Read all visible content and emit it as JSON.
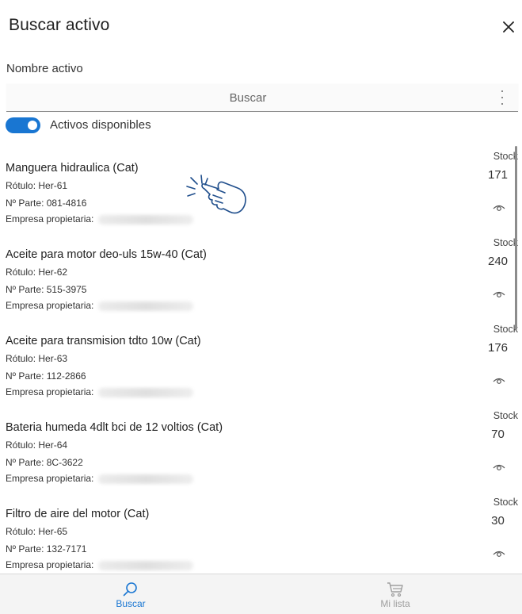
{
  "dialog": {
    "title": "Buscar activo",
    "close_icon": "close-icon"
  },
  "search": {
    "label": "Nombre activo",
    "placeholder": "Buscar",
    "value": "",
    "menu_icon": "more-vert-icon"
  },
  "filter": {
    "label": "Activos disponibles",
    "enabled": true,
    "accent_color": "#1976d2"
  },
  "assets": {
    "stock_label": "Stock",
    "rotulo_prefix": "Rótulo:",
    "part_prefix": "Nº Parte:",
    "owner_prefix": "Empresa propietaria:",
    "items": [
      {
        "name": "Manguera hidraulica (Cat)",
        "rotulo": "Her-61",
        "part": "081-4816",
        "stock": "171"
      },
      {
        "name": "Aceite para motor deo-uls 15w-40 (Cat)",
        "rotulo": "Her-62",
        "part": "515-3975",
        "stock": "240"
      },
      {
        "name": "Aceite para transmision tdto 10w (Cat)",
        "rotulo": "Her-63",
        "part": "112-2866",
        "stock": "176"
      },
      {
        "name": "Bateria humeda 4dlt bci de 12 voltios (Cat)",
        "rotulo": "Her-64",
        "part": "8C-3622",
        "stock": "70"
      },
      {
        "name": "Filtro de aire del motor (Cat)",
        "rotulo": "Her-65",
        "part": "132-7171",
        "stock": "30"
      }
    ]
  },
  "bottom_nav": {
    "tabs": [
      {
        "label": "Buscar",
        "icon": "search-icon",
        "active": true
      },
      {
        "label": "Mi lista",
        "icon": "cart-icon",
        "active": false
      }
    ],
    "active_color": "#1976d2",
    "inactive_color": "#9e9e9e"
  }
}
